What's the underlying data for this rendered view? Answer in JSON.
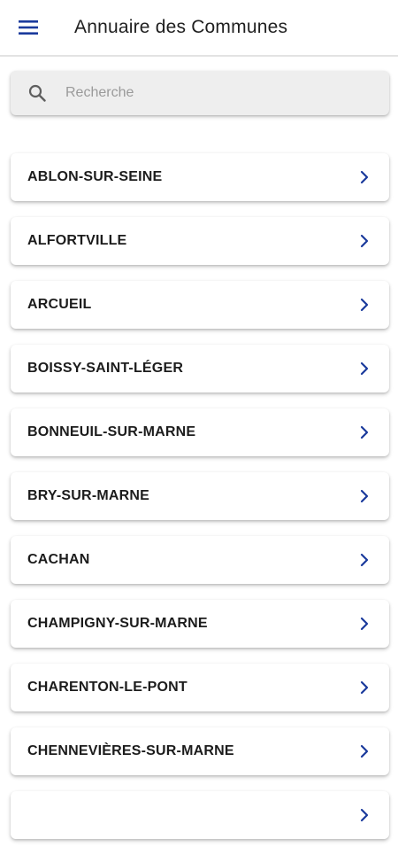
{
  "appbar": {
    "title": "Annuaire des Communes",
    "menu_icon": "hamburger-menu-icon",
    "accent_color": "#1a3a9c"
  },
  "search": {
    "placeholder": "Recherche",
    "value": "",
    "icon": "search-icon"
  },
  "communes": [
    "ABLON-SUR-SEINE",
    "ALFORTVILLE",
    "ARCUEIL",
    "BOISSY-SAINT-LÉGER",
    "BONNEUIL-SUR-MARNE",
    "BRY-SUR-MARNE",
    "CACHAN",
    "CHAMPIGNY-SUR-MARNE",
    "CHARENTON-LE-PONT",
    "CHENNEVIÈRES-SUR-MARNE",
    ""
  ],
  "item_icon": "chevron-right-icon"
}
